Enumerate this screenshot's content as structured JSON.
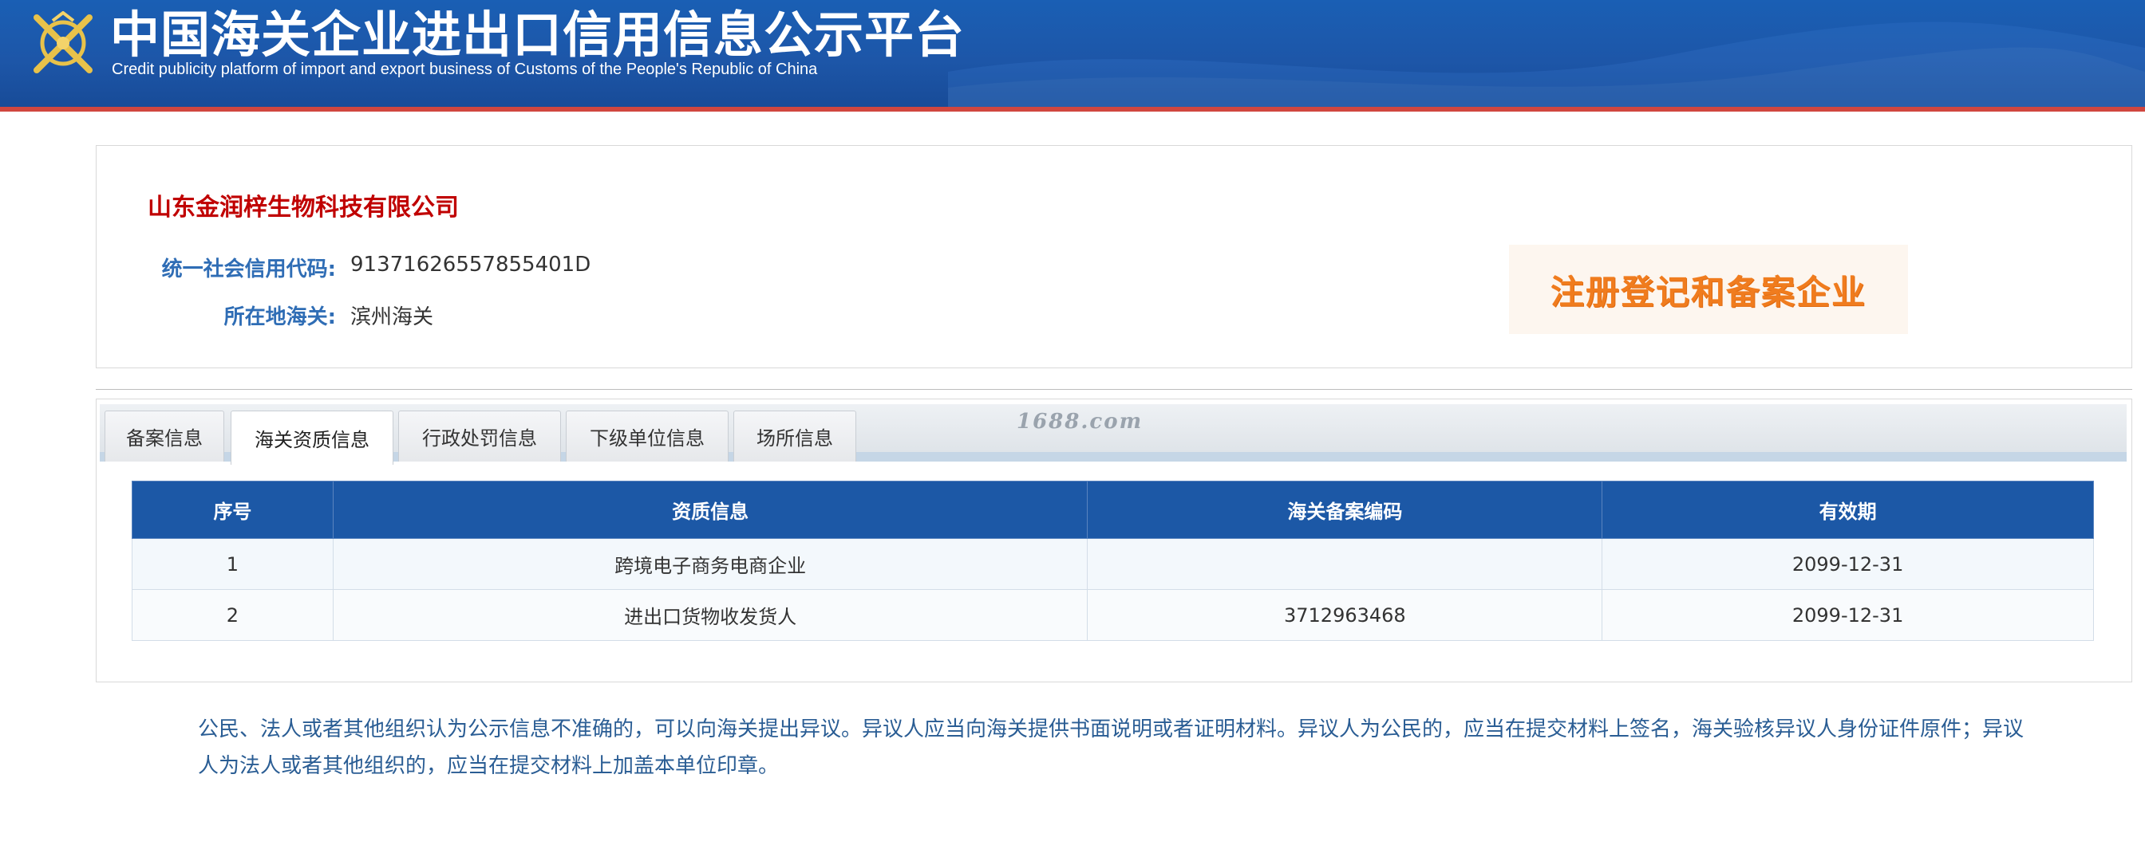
{
  "header": {
    "title": "中国海关企业进出口信用信息公示平台",
    "subtitle": "Credit publicity platform of import and export business of Customs of the People's Republic of China",
    "emblem_icon": "customs-emblem-icon"
  },
  "company": {
    "name": "山东金润梓生物科技有限公司",
    "code_label": "统一社会信用代码:",
    "code_value": "91371626557855401D",
    "customs_label": "所在地海关:",
    "customs_value": "滨州海关",
    "status": "注册登记和备案企业"
  },
  "tabs": [
    {
      "label": "备案信息",
      "active": false
    },
    {
      "label": "海关资质信息",
      "active": true
    },
    {
      "label": "行政处罚信息",
      "active": false
    },
    {
      "label": "下级单位信息",
      "active": false
    },
    {
      "label": "场所信息",
      "active": false
    }
  ],
  "watermark": "1688.com",
  "table": {
    "headers": [
      "序号",
      "资质信息",
      "海关备案编码",
      "有效期"
    ],
    "rows": [
      [
        "1",
        "跨境电子商务电商企业",
        "",
        "2099-12-31"
      ],
      [
        "2",
        "进出口货物收发货人",
        "3712963468",
        "2099-12-31"
      ]
    ]
  },
  "notice": "公民、法人或者其他组织认为公示信息不准确的，可以向海关提出异议。异议人应当向海关提供书面说明或者证明材料。异议人为公民的，应当在提交材料上签名，海关验核异议人身份证件原件；异议人为法人或者其他组织的，应当在提交材料上加盖本单位印章。",
  "colors": {
    "header_blue": "#1d56a8",
    "company_red": "#c00000",
    "label_blue": "#2f6db5",
    "status_orange": "#f07c1e",
    "table_header": "#1c58a6"
  }
}
